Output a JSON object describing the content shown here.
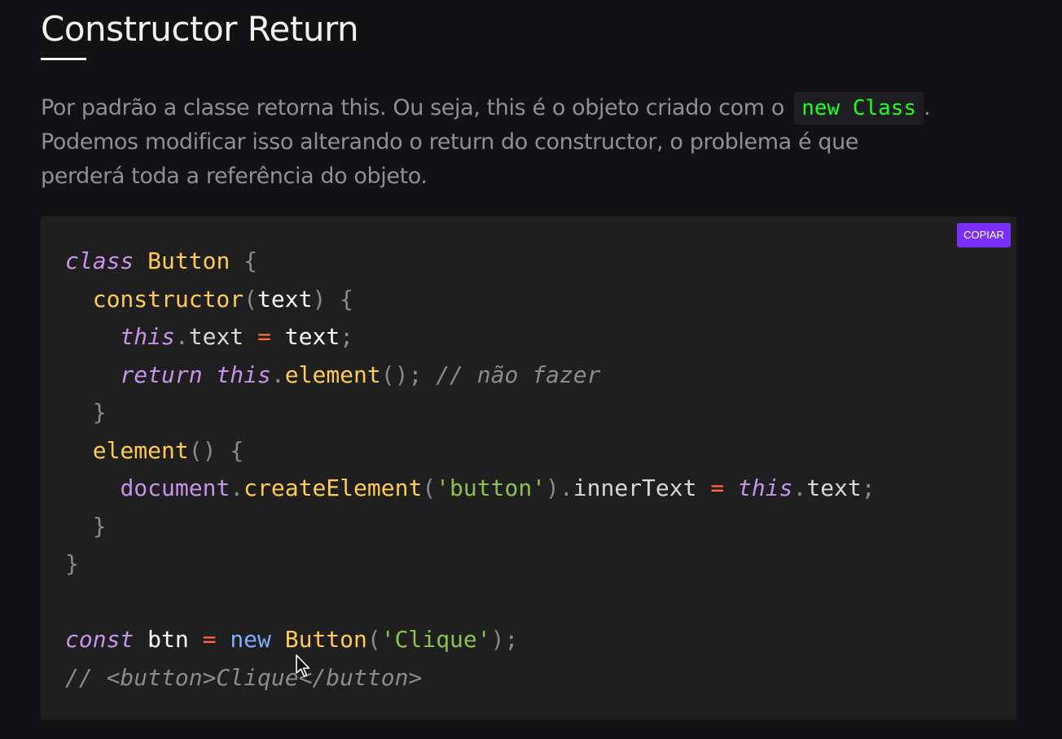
{
  "article": {
    "title": "Constructor Return",
    "intro_before": "Por padrão a classe retorna this. Ou seja, this é o objeto criado com o",
    "inline_code": "new Class",
    "intro_after": ". Podemos modificar isso alterando o return do constructor, o problema é que perderá toda a referência do objeto."
  },
  "code_block": {
    "copy_label": "COPIAR",
    "tokens": {
      "class_kw": "class",
      "class_name": "Button",
      "constructor": "constructor",
      "param_text": "text",
      "this": "this",
      "prop_text": "text",
      "return_kw": "return",
      "element": "element",
      "comment1": "// não fazer",
      "document": "document",
      "createElement": "createElement",
      "str_button": "'button'",
      "innerText": "innerText",
      "const_kw": "const",
      "btn": "btn",
      "new_kw": "new",
      "str_clique": "'Clique'",
      "comment2": "// <button>Clique</button>"
    }
  }
}
